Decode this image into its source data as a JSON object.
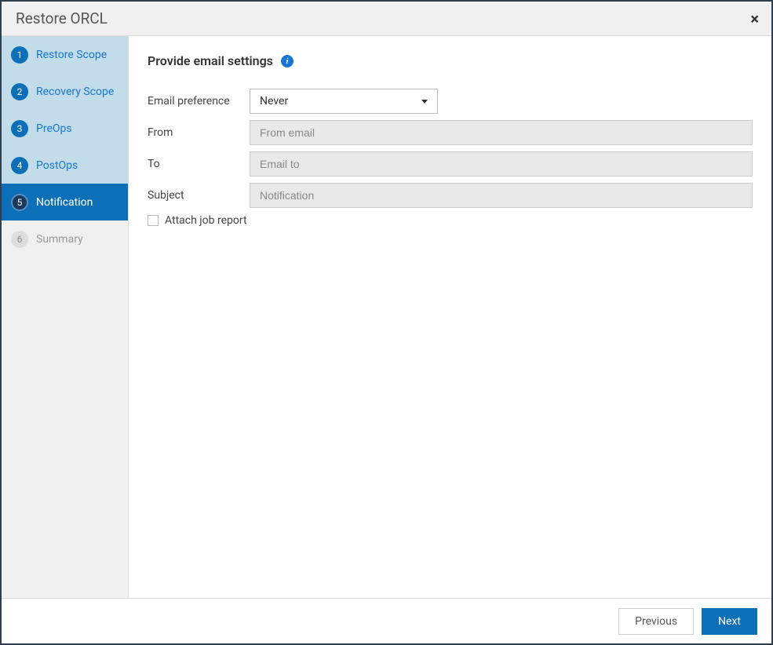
{
  "dialog": {
    "title": "Restore ORCL"
  },
  "steps": [
    {
      "num": "1",
      "label": "Restore Scope",
      "state": "completed"
    },
    {
      "num": "2",
      "label": "Recovery Scope",
      "state": "completed"
    },
    {
      "num": "3",
      "label": "PreOps",
      "state": "completed"
    },
    {
      "num": "4",
      "label": "PostOps",
      "state": "completed"
    },
    {
      "num": "5",
      "label": "Notification",
      "state": "active"
    },
    {
      "num": "6",
      "label": "Summary",
      "state": "disabled"
    }
  ],
  "content": {
    "title": "Provide email settings",
    "fields": {
      "email_preference": {
        "label": "Email preference",
        "value": "Never"
      },
      "from": {
        "label": "From",
        "placeholder": "From email",
        "value": ""
      },
      "to": {
        "label": "To",
        "placeholder": "Email to",
        "value": ""
      },
      "subject": {
        "label": "Subject",
        "placeholder": "Notification",
        "value": ""
      }
    },
    "attach_job_report": {
      "label": "Attach job report",
      "checked": false
    }
  },
  "footer": {
    "previous": "Previous",
    "next": "Next"
  }
}
